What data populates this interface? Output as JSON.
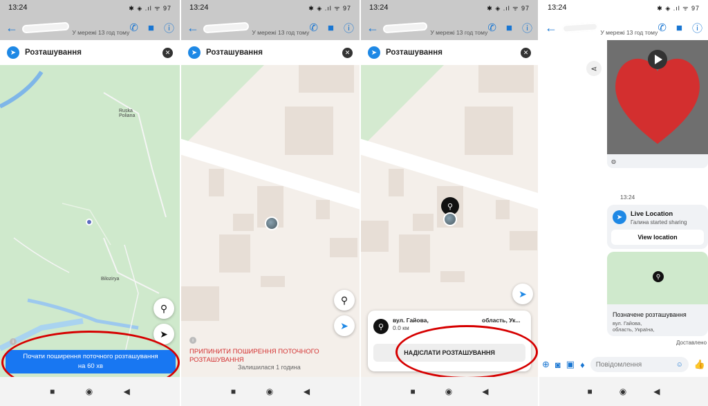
{
  "colors": {
    "accent": "#1877f2",
    "map_green": "#cfe9cc",
    "map_beige": "#f4efea",
    "red_annotation": "#d60000",
    "heart": "#d32f2f"
  },
  "status": {
    "time": "13:24",
    "icons": "✱ ◈ .ıl ᯤ 97"
  },
  "chat": {
    "subtitle": "У мережі 13 год тому"
  },
  "sheet": {
    "title": "Розташування"
  },
  "panel1": {
    "places": [
      "Ruska Poliana",
      "Bilozirya"
    ],
    "start_button_line1": "Почати поширення поточного розташування",
    "start_button_line2": "на 60 хв"
  },
  "panel2": {
    "stop_line1": "ПРИПИНИТИ ПОШИРЕННЯ ПОТОЧНОГО",
    "stop_line2": "РОЗТАШУВАННЯ",
    "remaining": "Залишилася 1 година"
  },
  "panel3": {
    "address": "вул. Гайова,",
    "address_tail": "область, Ук...",
    "distance": "0.0 км",
    "send_button": "НАДІСЛАТИ РОЗТАШУВАННЯ"
  },
  "panel4": {
    "timestamp": "13:24",
    "live_title": "Live Location",
    "live_sub": "Галина started sharing",
    "view_button": "View location",
    "pinned_title": "Позначене розташування",
    "pinned_addr1": "вул. Гайова,",
    "pinned_addr2": "область, Україна,",
    "delivered": "Доставлено",
    "compose_placeholder": "Повідомлення"
  }
}
